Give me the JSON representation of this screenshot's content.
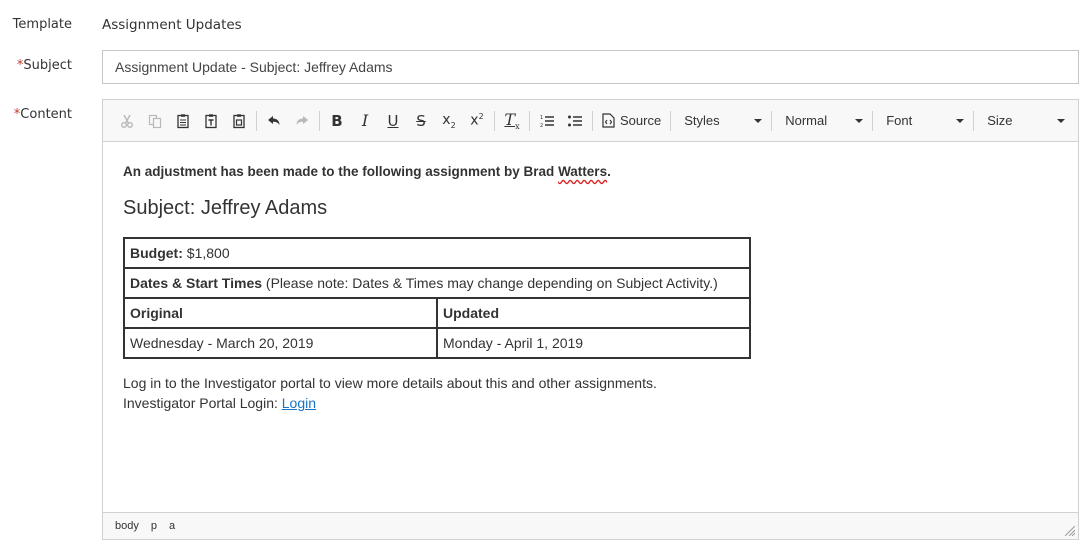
{
  "form": {
    "template_label": "Template",
    "template_value": "Assignment Updates",
    "subject_label": "Subject",
    "subject_value": "Assignment Update - Subject: Jeffrey Adams",
    "content_label": "Content",
    "required_marker": "*"
  },
  "toolbar": {
    "source_label": "Source",
    "styles_label": "Styles",
    "format_label": "Normal",
    "font_label": "Font",
    "size_label": "Size"
  },
  "content": {
    "intro_prefix": "An adjustment has been made to the following assignment by Brad ",
    "intro_name": "Watters",
    "intro_suffix": ".",
    "subject_heading": "Subject: Jeffrey Adams",
    "budget_label": "Budget:",
    "budget_value": " $1,800",
    "dates_label": "Dates & Start Times",
    "dates_note": " (Please note: Dates & Times may change depending on Subject Activity.)",
    "col_original": "Original",
    "col_updated": "Updated",
    "original_date": "Wednesday - March 20, 2019",
    "updated_date": "Monday - April 1, 2019",
    "footer_line1": "Log in to the Investigator portal to view more details about this and other assignments.",
    "footer_line2_prefix": "Investigator Portal Login: ",
    "login_link": "Login"
  },
  "statusbar": {
    "path": [
      "body",
      "p",
      "a"
    ]
  },
  "colors": {
    "required": "#c0392b",
    "link": "#1a73c8",
    "toolbar_bg": "#f8f8f8",
    "border": "#d1d1d1"
  }
}
